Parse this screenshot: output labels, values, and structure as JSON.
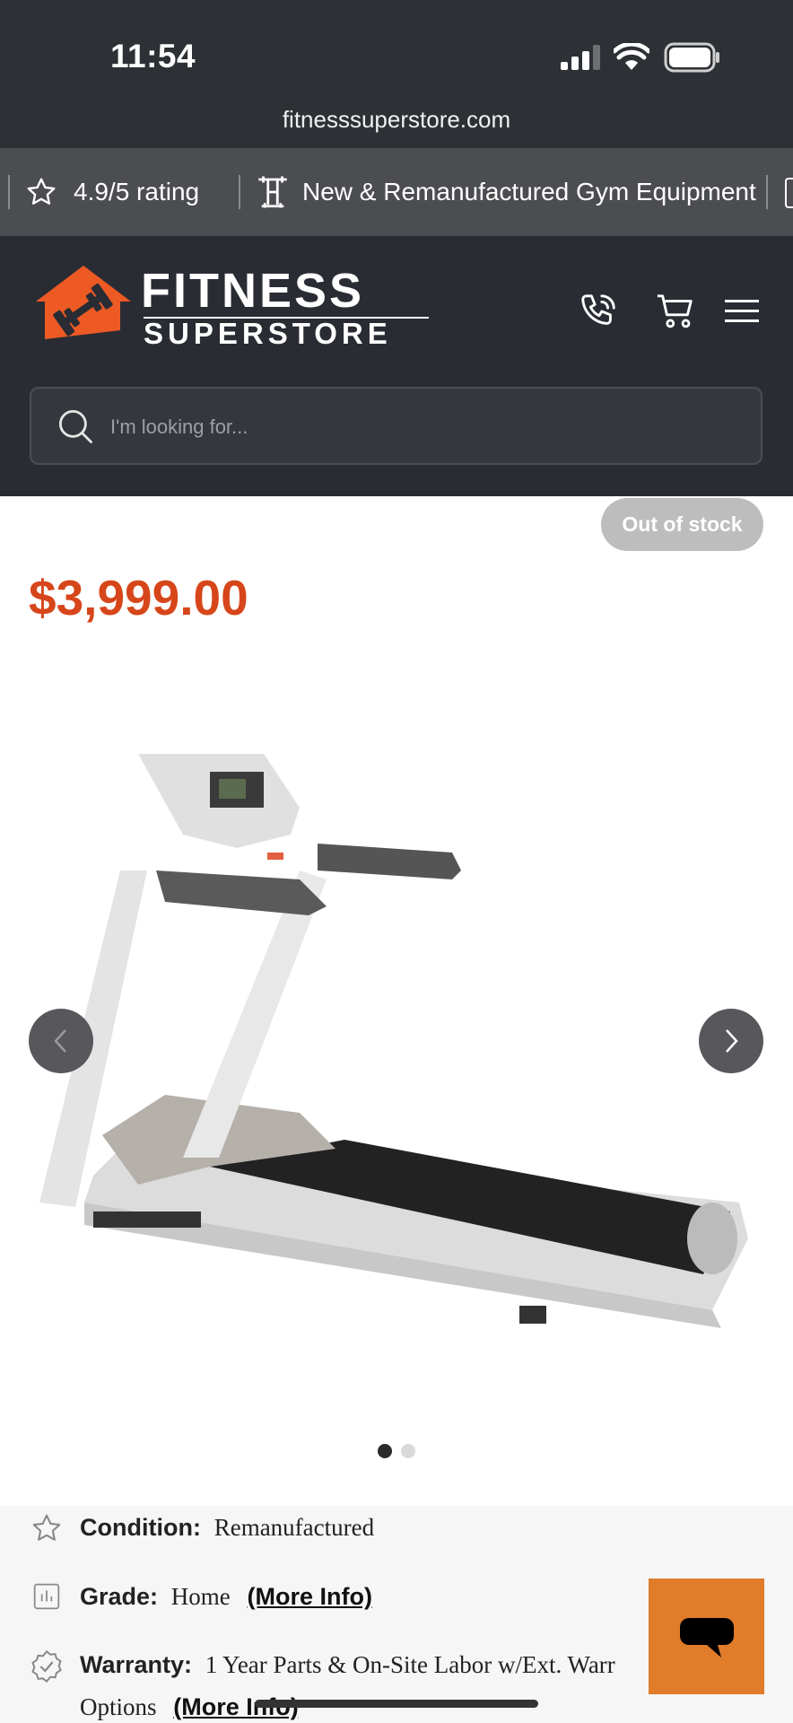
{
  "status_bar": {
    "time": "11:54"
  },
  "browser": {
    "url": "fitnesssuperstore.com"
  },
  "promo": {
    "items": [
      {
        "icon": "star-outline-icon",
        "label": "4.9/5 rating"
      },
      {
        "icon": "dumbbell-rack-icon",
        "label": "New & Remanufactured Gym Equipment"
      }
    ]
  },
  "header": {
    "logo_line1": "FITNESS",
    "logo_line2": "SUPERSTORE",
    "icons": [
      "phone-icon",
      "cart-icon",
      "menu-icon"
    ]
  },
  "search": {
    "placeholder": "I'm looking for..."
  },
  "product": {
    "stock_badge": "Out of stock",
    "price": "$3,999.00",
    "image_count": 2,
    "active_image": 1
  },
  "specs": {
    "condition_label": "Condition:",
    "condition_value": "Remanufactured",
    "grade_label": "Grade:",
    "grade_value": "Home",
    "grade_link": "(More Info)",
    "warranty_label": "Warranty:",
    "warranty_value": "1 Year Parts & On-Site Labor w/Ext. Warr",
    "warranty_line2": "Options",
    "warranty_link": "(More Info)"
  },
  "colors": {
    "accent": "#d6461a",
    "header_bg": "#2a2c34",
    "chat_button": "#e07c2a"
  }
}
